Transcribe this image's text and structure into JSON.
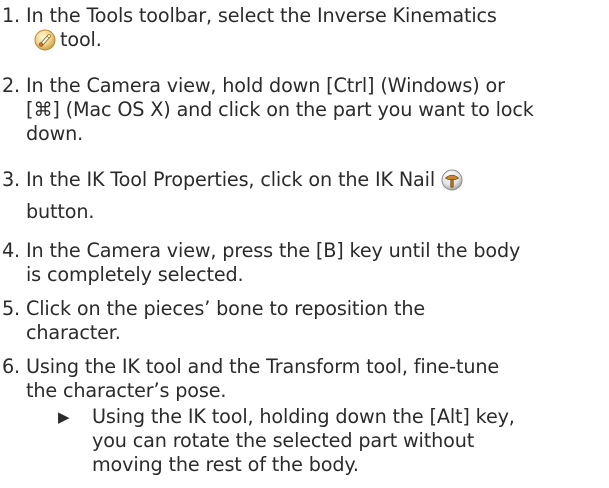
{
  "steps": [
    {
      "number": "1.",
      "lines": [
        "In the Tools toolbar, select the Inverse Kinematics",
        "tool."
      ],
      "icon": "ik-tool-icon"
    },
    {
      "number": "2.",
      "lines": [
        "In the Camera view, hold down [Ctrl] (Windows) or",
        "[⌘] (Mac OS X) and click on the part you want to lock",
        "down."
      ]
    },
    {
      "number": "3.",
      "lines": [
        "In the IK Tool Properties, click on the IK Nail",
        "button."
      ],
      "icon": "ik-nail-icon"
    },
    {
      "number": "4.",
      "lines": [
        "In the Camera view, press the [B] key until the body",
        "is completely selected."
      ]
    },
    {
      "number": "5.",
      "lines": [
        "Click on the pieces’ bone to reposition the",
        "character."
      ]
    },
    {
      "number": "6.",
      "lines": [
        "Using the IK tool and the Transform tool, fine-tune",
        "the character’s pose."
      ]
    }
  ],
  "tip": {
    "bullet": "▶",
    "lines": [
      "Using the IK tool, holding down the [Alt] key,",
      "you can rotate the selected part without",
      "moving the rest of the body."
    ]
  }
}
